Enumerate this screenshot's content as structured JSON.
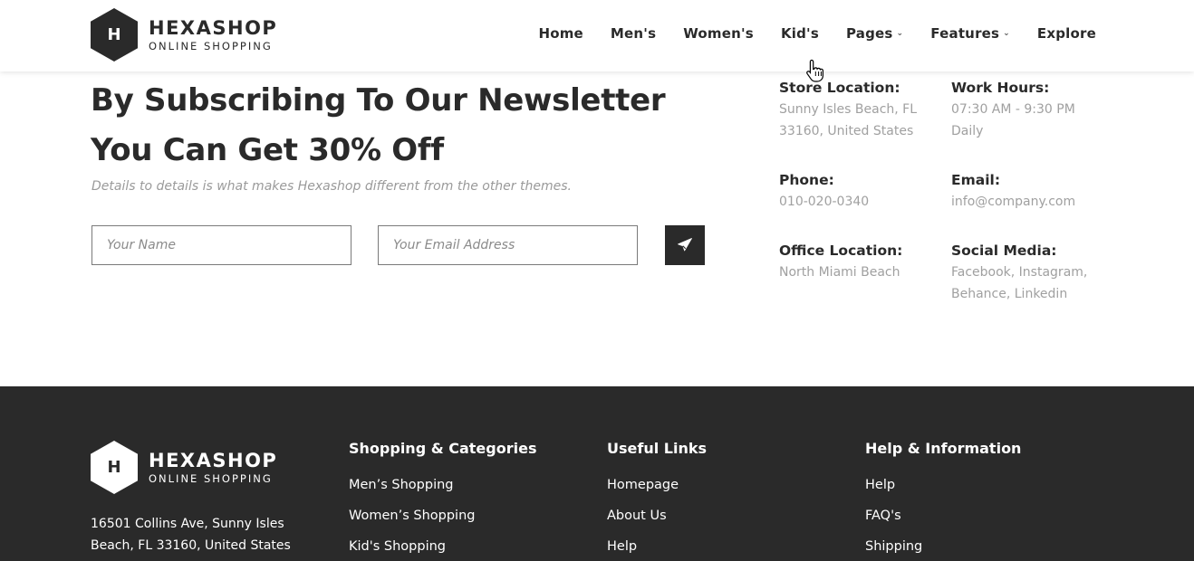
{
  "header": {
    "logo": {
      "mark": "H",
      "name": "HEXASHOP",
      "tagline": "ONLINE SHOPPING"
    },
    "nav": [
      {
        "label": "Home",
        "dropdown": false
      },
      {
        "label": "Men's",
        "dropdown": false
      },
      {
        "label": "Women's",
        "dropdown": false
      },
      {
        "label": "Kid's",
        "dropdown": false
      },
      {
        "label": "Pages",
        "dropdown": true
      },
      {
        "label": "Features",
        "dropdown": true
      },
      {
        "label": "Explore",
        "dropdown": false
      }
    ]
  },
  "newsletter": {
    "title": "By Subscribing To Our Newsletter You Can Get 30% Off",
    "description": "Details to details is what makes Hexashop different from the other themes.",
    "name_placeholder": "Your Name",
    "email_placeholder": "Your Email Address",
    "submit_icon": "paper-plane-icon"
  },
  "info": {
    "store_location": {
      "label": "Store Location:",
      "value": "Sunny Isles Beach, FL 33160, United States"
    },
    "work_hours": {
      "label": "Work Hours:",
      "value": "07:30 AM - 9:30 PM Daily"
    },
    "phone": {
      "label": "Phone:",
      "value": "010-020-0340"
    },
    "email": {
      "label": "Email:",
      "value": "info@company.com"
    },
    "office_location": {
      "label": "Office Location:",
      "value": "North Miami Beach"
    },
    "social_media": {
      "label": "Social Media:",
      "value": "Facebook, Instagram, Behance, Linkedin"
    }
  },
  "footer": {
    "logo": {
      "mark": "H",
      "name": "HEXASHOP",
      "tagline": "ONLINE SHOPPING"
    },
    "address": "16501 Collins Ave, Sunny Isles Beach, FL 33160, United States",
    "columns": [
      {
        "title": "Shopping & Categories",
        "links": [
          "Men’s Shopping",
          "Women’s Shopping",
          "Kid's Shopping"
        ]
      },
      {
        "title": "Useful Links",
        "links": [
          "Homepage",
          "About Us",
          "Help"
        ]
      },
      {
        "title": "Help & Information",
        "links": [
          "Help",
          "FAQ's",
          "Shipping"
        ]
      }
    ]
  },
  "colors": {
    "dark": "#2a2a2a",
    "muted": "#a0a0a0",
    "white": "#ffffff"
  }
}
